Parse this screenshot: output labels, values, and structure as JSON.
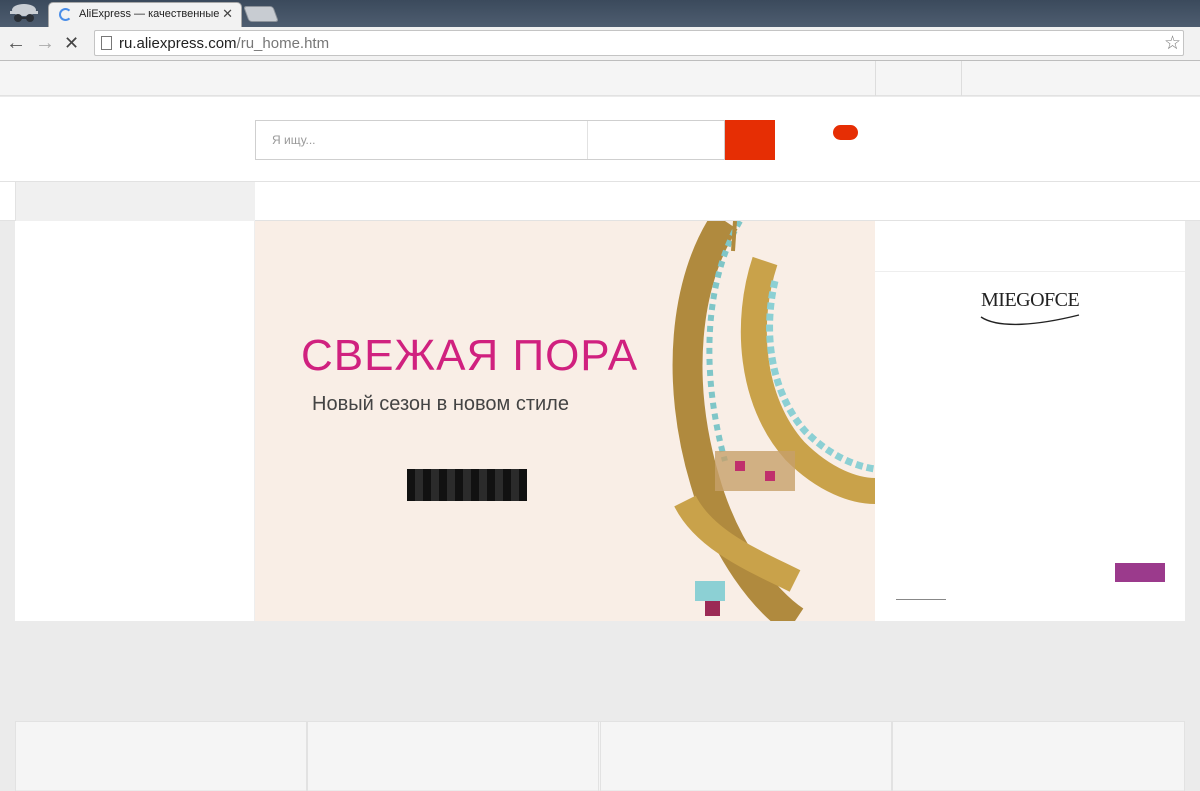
{
  "browser": {
    "tab_title": "AliExpress — качественные",
    "tab_close": "✕",
    "url_host": "ru.aliexpress.com",
    "url_path": "/ru_home.htm",
    "back_icon": "←",
    "forward_icon": "→",
    "stop_icon": "✕",
    "star_icon": "☆"
  },
  "header": {
    "search_placeholder": "Я ищу...",
    "brand_color": "#e62e04"
  },
  "banner": {
    "headline": "СВЕЖАЯ ПОРА",
    "subtitle": "Новый сезон в новом стиле",
    "headline_color": "#d0217f"
  },
  "sidebar_promo": {
    "brand_logo": "MIEGOFCE",
    "accent_color": "#9b3a8c"
  }
}
